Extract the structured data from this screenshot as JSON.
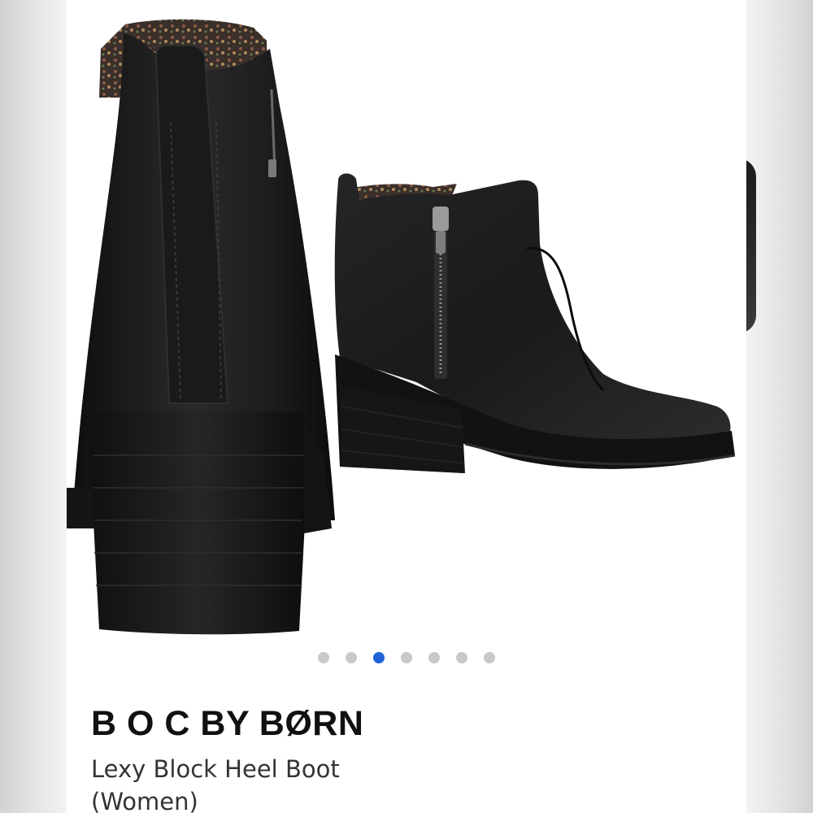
{
  "product": {
    "brand": "B O C BY BØRN",
    "name": "Lexy Block Heel Boot (Women)"
  },
  "gallery": {
    "image_count": 7,
    "active_index": 2,
    "colors": {
      "active_dot": "#1f63d6",
      "inactive_dot": "#c9c9c9",
      "boot_leather": "#1b1b1b"
    },
    "images": [
      {
        "name": "boot-back-view"
      },
      {
        "name": "boot-side-view"
      }
    ]
  }
}
